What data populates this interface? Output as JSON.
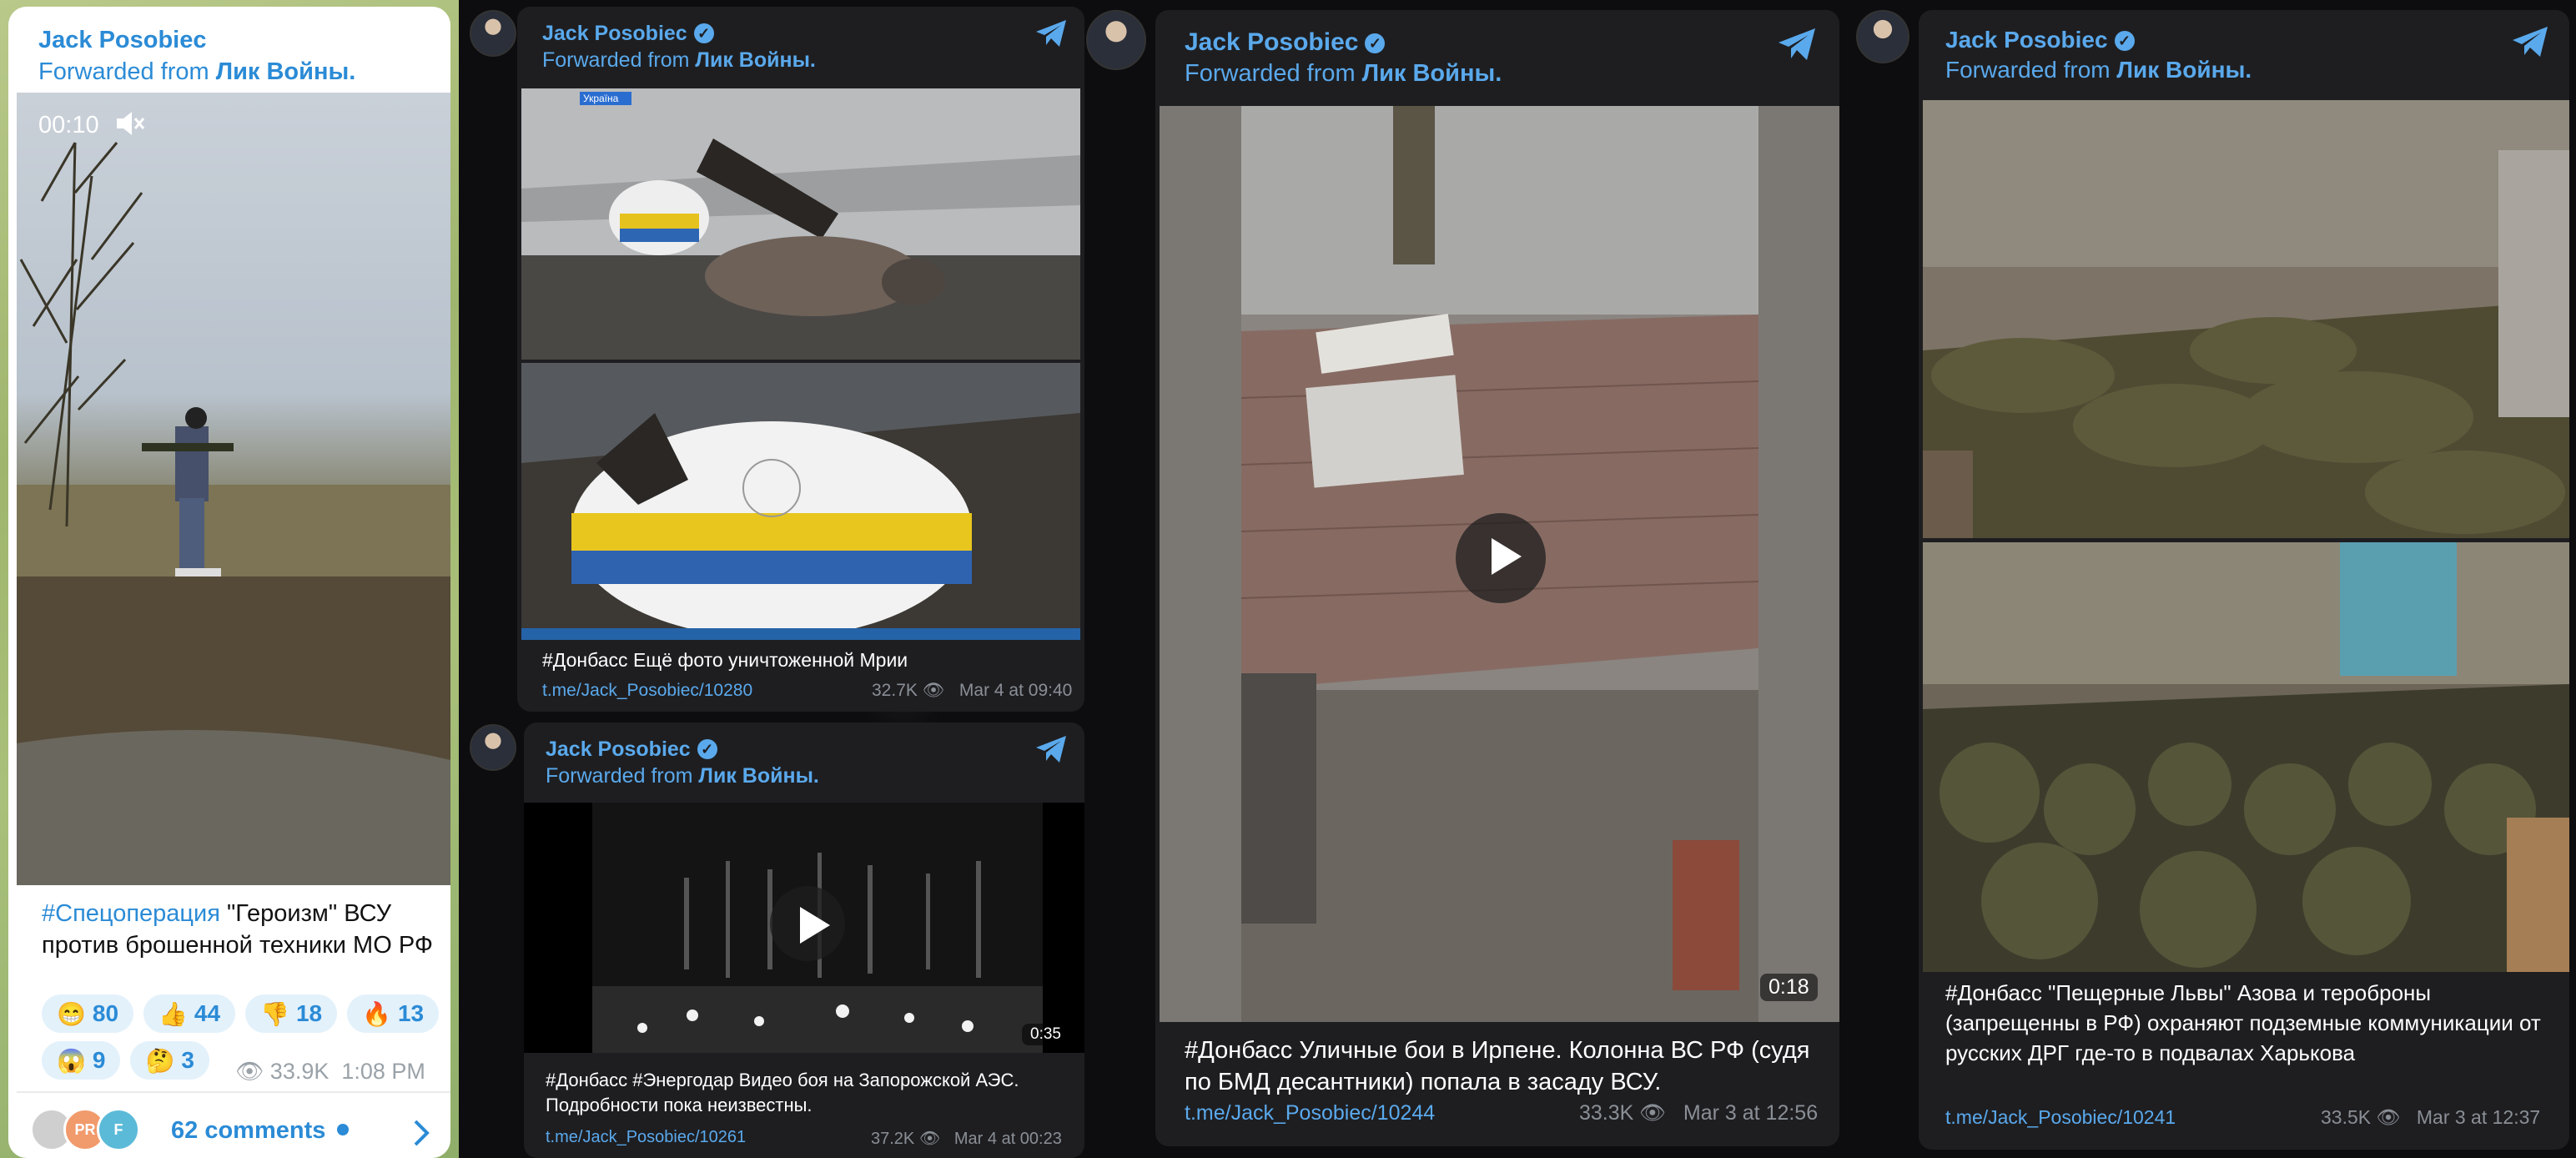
{
  "panel1": {
    "author": "Jack Posobiec",
    "forwarded_prefix": "Forwarded from",
    "forwarded_source": "Лик Войны.",
    "video_time": "00:10",
    "caption_hashtag": "#Спецоперация",
    "caption_text": " \"Героизм\" ВСУ против брошенной техники МО РФ",
    "reactions": [
      {
        "emoji": "😁",
        "count": "80"
      },
      {
        "emoji": "👍",
        "count": "44"
      },
      {
        "emoji": "👎",
        "count": "18"
      },
      {
        "emoji": "🔥",
        "count": "13"
      },
      {
        "emoji": "😱",
        "count": "9"
      },
      {
        "emoji": "🤔",
        "count": "3"
      }
    ],
    "views": "33.9K",
    "time": "1:08 PM",
    "comment_avatars": [
      "PR",
      "F"
    ],
    "comments_label": "62 comments"
  },
  "post2": {
    "author": "Jack Posobiec",
    "forwarded_prefix": "Forwarded from",
    "forwarded_source": "Лик Войны.",
    "img_badge": "Україна",
    "caption": "#Донбасс Ещё фото уничтоженной Мрии",
    "link": "t.me/Jack_Posobiec/10280",
    "views": "32.7K",
    "date": "Mar 4 at 09:40"
  },
  "post3": {
    "author": "Jack Posobiec",
    "forwarded_prefix": "Forwarded from",
    "forwarded_source": "Лик Войны.",
    "duration": "0:35",
    "caption": "#Донбасс #Энергодар Видео боя на Запорожской АЭС. Подробности пока неизвестны.",
    "link": "t.me/Jack_Posobiec/10261",
    "views": "37.2K",
    "date": "Mar 4 at 00:23"
  },
  "post4": {
    "author": "Jack Posobiec",
    "forwarded_prefix": "Forwarded from",
    "forwarded_source": "Лик Войны.",
    "duration": "0:18",
    "caption": "#Донбасс Уличные бои в Ирпене. Колонна ВС РФ (судя по БМД десантники) попала в засаду ВСУ.",
    "link": "t.me/Jack_Posobiec/10244",
    "views": "33.3K",
    "date": "Mar 3 at 12:56"
  },
  "post5": {
    "author": "Jack Posobiec",
    "forwarded_prefix": "Forwarded from",
    "forwarded_source": "Лик Войны.",
    "caption": "#Донбасс \"Пещерные Львы\" Азова и тероброны (запрещенны в РФ) охраняют подземные коммуникации от русских ДРГ где-то в подвалах Харькова",
    "link": "t.me/Jack_Posobiec/10241",
    "views": "33.5K",
    "date": "Mar 3 at 12:37"
  },
  "colors": {
    "link_blue_light": "#2b8bd6",
    "link_blue_dark": "#5aa9ec",
    "card_dark": "#1e1e21",
    "reaction_bg": "#e3f1fb"
  }
}
